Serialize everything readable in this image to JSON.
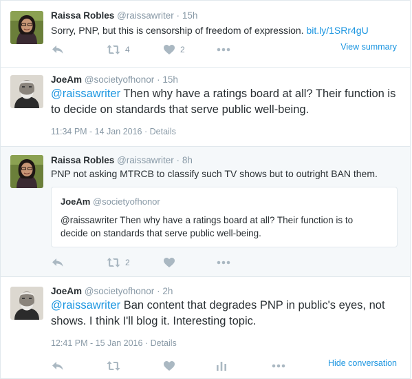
{
  "tweets": [
    {
      "fullname": "Raissa Robles",
      "handle": "@raissawriter",
      "age": "15h",
      "text": "Sorry, PNP, but this is censorship of freedom of expression.",
      "link": "bit.ly/1SRr4gU",
      "retweet_count": "4",
      "like_count": "2",
      "view_summary": "View summary"
    },
    {
      "fullname": "JoeAm",
      "handle": "@societyofhonor",
      "age": "15h",
      "mention": "@raissawriter",
      "text": "Then why have a ratings board at all? Their function is to decide on standards that serve public well-being.",
      "timestamp": "11:34 PM - 14 Jan 2016",
      "details": "Details"
    },
    {
      "fullname": "Raissa Robles",
      "handle": "@raissawriter",
      "age": "8h",
      "text": "PNP not asking MTRCB to classify such TV shows but to outright BAN them.",
      "quote": {
        "fullname": "JoeAm",
        "handle": "@societyofhonor",
        "line1": "@raissawriter Then why have a ratings board at all? Their function is to",
        "line2": "decide on standards that serve public well-being."
      },
      "retweet_count": "2"
    },
    {
      "fullname": "JoeAm",
      "handle": "@societyofhonor",
      "age": "2h",
      "mention": "@raissawriter",
      "line1": "Ban content that degrades PNP in public's eyes, not",
      "line2": "shows. I think I'll blog it. Interesting topic.",
      "timestamp": "12:41 PM - 15 Jan 2016",
      "details": "Details",
      "hide_conversation": "Hide conversation"
    }
  ],
  "separator": "·",
  "dash": "·",
  "colors": {
    "link": "#1b95e0",
    "meta": "#8899a6",
    "icon": "#aab8c2",
    "border": "#e1e8ed",
    "shade": "#f5f8fa"
  },
  "icons": [
    "reply-icon",
    "retweet-icon",
    "heart-icon",
    "more-icon",
    "analytics-icon"
  ]
}
